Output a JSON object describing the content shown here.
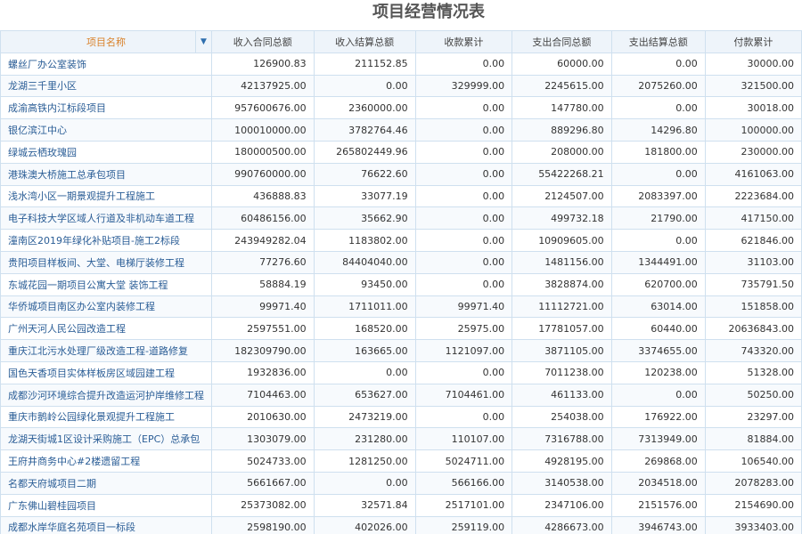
{
  "title": "项目经营情况表",
  "headers": [
    "项目名称",
    "收入合同总额",
    "收入结算总额",
    "收款累计",
    "支出合同总额",
    "支出结算总额",
    "付款累计"
  ],
  "rows": [
    [
      "螺丝厂办公室装饰",
      "126900.83",
      "211152.85",
      "0.00",
      "60000.00",
      "0.00",
      "30000.00"
    ],
    [
      "龙湖三千里小区",
      "42137925.00",
      "0.00",
      "329999.00",
      "2245615.00",
      "2075260.00",
      "321500.00"
    ],
    [
      "成渝高铁内江标段项目",
      "957600676.00",
      "2360000.00",
      "0.00",
      "147780.00",
      "0.00",
      "30018.00"
    ],
    [
      "银亿滨江中心",
      "100010000.00",
      "3782764.46",
      "0.00",
      "889296.80",
      "14296.80",
      "100000.00"
    ],
    [
      "绿城云栖玫瑰园",
      "180000500.00",
      "265802449.96",
      "0.00",
      "208000.00",
      "181800.00",
      "230000.00"
    ],
    [
      "港珠澳大桥施工总承包项目",
      "990760000.00",
      "76622.60",
      "0.00",
      "55422268.21",
      "0.00",
      "4161063.00"
    ],
    [
      "浅水湾小区一期景观提升工程施工",
      "436888.83",
      "33077.19",
      "0.00",
      "2124507.00",
      "2083397.00",
      "2223684.00"
    ],
    [
      "电子科技大学区域人行道及非机动车道工程",
      "60486156.00",
      "35662.90",
      "0.00",
      "499732.18",
      "21790.00",
      "417150.00"
    ],
    [
      "潼南区2019年绿化补贴项目-施工2标段",
      "243949282.04",
      "1183802.00",
      "0.00",
      "10909605.00",
      "0.00",
      "621846.00"
    ],
    [
      "贵阳项目样板间、大堂、电梯厅装修工程",
      "77276.60",
      "84404040.00",
      "0.00",
      "1481156.00",
      "1344491.00",
      "31103.00"
    ],
    [
      "东城花园一期项目公寓大堂 装饰工程",
      "58884.19",
      "93450.00",
      "0.00",
      "3828874.00",
      "620700.00",
      "735791.50"
    ],
    [
      "华侨城项目南区办公室内装修工程",
      "99971.40",
      "1711011.00",
      "99971.40",
      "11112721.00",
      "63014.00",
      "151858.00"
    ],
    [
      "广州天河人民公园改造工程",
      "2597551.00",
      "168520.00",
      "25975.00",
      "17781057.00",
      "60440.00",
      "20636843.00"
    ],
    [
      "重庆江北污水处理厂级改造工程-道路修复",
      "182309790.00",
      "163665.00",
      "1121097.00",
      "3871105.00",
      "3374655.00",
      "743320.00"
    ],
    [
      "国色天香项目实体样板房区域园建工程",
      "1932836.00",
      "0.00",
      "0.00",
      "7011238.00",
      "120238.00",
      "51328.00"
    ],
    [
      "成都沙河环境综合提升改造运河护岸维修工程",
      "7104463.00",
      "653627.00",
      "7104461.00",
      "461133.00",
      "0.00",
      "50250.00"
    ],
    [
      "重庆市鹅岭公园绿化景观提升工程施工",
      "2010630.00",
      "2473219.00",
      "0.00",
      "254038.00",
      "176922.00",
      "23297.00"
    ],
    [
      "龙湖天街城1区设计采购施工（EPC）总承包",
      "1303079.00",
      "231280.00",
      "110107.00",
      "7316788.00",
      "7313949.00",
      "81884.00"
    ],
    [
      "王府井商务中心#2楼遗留工程",
      "5024733.00",
      "1281250.00",
      "5024711.00",
      "4928195.00",
      "269868.00",
      "106540.00"
    ],
    [
      "名都天府城项目二期",
      "5661667.00",
      "0.00",
      "566166.00",
      "3140538.00",
      "2034518.00",
      "2078283.00"
    ],
    [
      "广东佛山碧桂园项目",
      "25373082.00",
      "32571.84",
      "2517101.00",
      "2347106.00",
      "2151576.00",
      "2154690.00"
    ],
    [
      "成都水岸华庭名苑项目一标段",
      "2598190.00",
      "402026.00",
      "259119.00",
      "4286673.00",
      "3946743.00",
      "3933403.00"
    ]
  ],
  "icons": {
    "sort": "sort-down-icon"
  }
}
